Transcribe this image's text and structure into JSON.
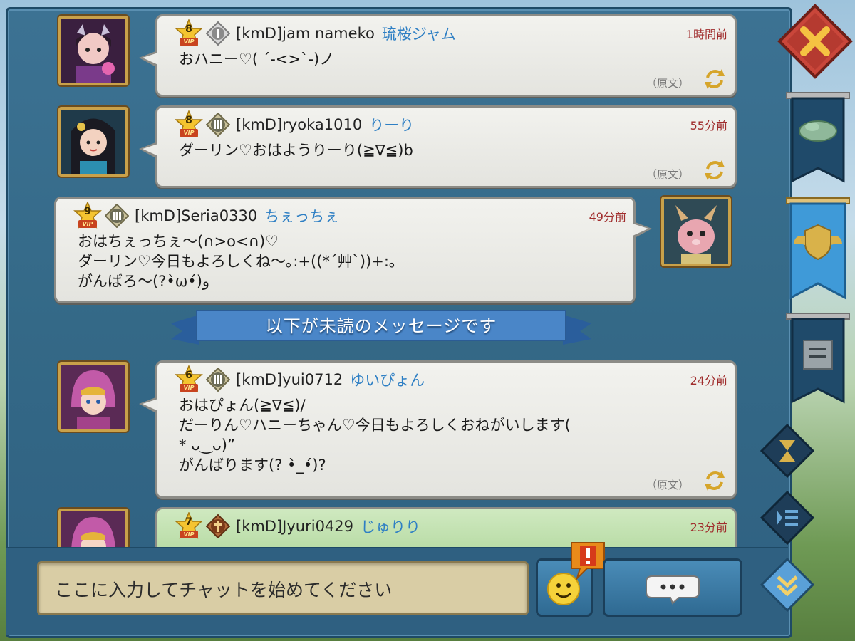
{
  "messages": [
    {
      "vip": "8",
      "vip_tag": "VIP",
      "user": "[kmD]jam nameko",
      "nick": "琉桜ジャム",
      "time": "1時間前",
      "text": "おハニー♡( ´-<>`-)ノ",
      "original": "（原文）",
      "rank": "I",
      "avatar": "avatar-girl-horns"
    },
    {
      "vip": "8",
      "vip_tag": "VIP",
      "user": "[kmD]ryoka1010",
      "nick": "りーり",
      "time": "55分前",
      "text": "ダーリン♡おはようりーり(≧∇≦)b",
      "original": "（原文）",
      "rank": "III",
      "avatar": "avatar-girl-dark-hair"
    },
    {
      "vip": "9",
      "vip_tag": "VIP",
      "user": "[kmD]Seria0330",
      "nick": "ちぇっちぇ",
      "time": "49分前",
      "text": "おはちぇっちぇ〜(∩>o<∩)♡\nダーリン♡今日もよろしくね〜｡:+((*´艸`))+:｡\nがんばろ〜(?•̀ω•́)و",
      "rank": "III",
      "avatar": "avatar-pink-creature"
    },
    {
      "vip": "6",
      "vip_tag": "VIP",
      "user": "[kmD]yui0712",
      "nick": "ゆいぴょん",
      "time": "24分前",
      "text": "おはぴょん(≧∇≦)/\nだーりん♡ハニーちゃん♡今日もよろしくおねがいします(\n* ᴗ‿ᴗ)”\nがんばります(? •̀_•́)?",
      "original": "（原文）",
      "rank": "III",
      "avatar": "avatar-pink-armor-girl"
    },
    {
      "vip": "7",
      "vip_tag": "VIP",
      "user": "[kmD]Jyuri0429",
      "nick": "じゅりり",
      "time": "23分前",
      "rank": "IV",
      "avatar": "avatar-pink-armor-girl"
    }
  ],
  "unread_banner": "以下が未読のメッセージです",
  "input": {
    "placeholder": "ここに入力してチャットを始めてください"
  },
  "colors": {
    "accent": "#2e7fc4",
    "time": "#a02d2d",
    "close": "#c9463a",
    "panel": "#346987"
  },
  "icons": {
    "close": "close-x-icon",
    "tab1": "map-icon",
    "tab2": "guild-crest-icon",
    "tab3": "scroll-icon",
    "side1": "hourglass-icon",
    "side2": "list-icon",
    "side3": "scroll-down-icon",
    "emoji": "smiley-icon",
    "alert": "exclamation-icon",
    "send": "speech-bubble-icon"
  }
}
